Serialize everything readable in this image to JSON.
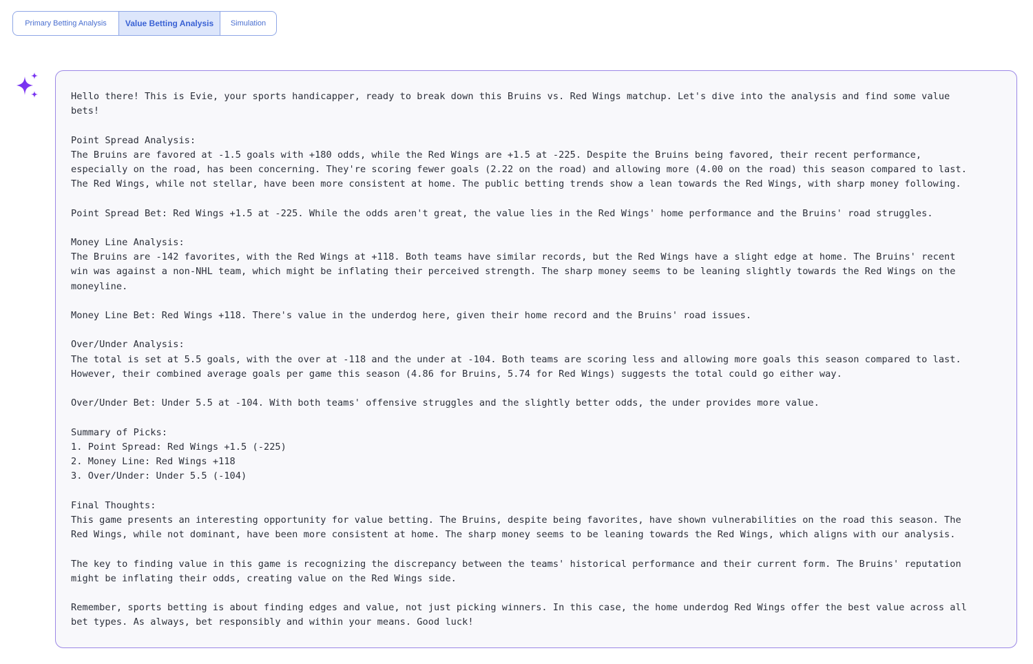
{
  "tabs": [
    {
      "label": "Primary Betting Analysis",
      "active": false
    },
    {
      "label": "Value Betting Analysis",
      "active": true
    },
    {
      "label": "Simulation",
      "active": false
    }
  ],
  "assistant_icon": "sparkles-icon",
  "colors": {
    "tab_border": "#8ea6e6",
    "tab_active_bg": "#dde6fb",
    "tab_text": "#4a6fd0",
    "bubble_border": "#9b87e6",
    "sparkle": "#7a2ff0"
  },
  "message": {
    "text": "Hello there! This is Evie, your sports handicapper, ready to break down this Bruins vs. Red Wings matchup. Let's dive into the analysis and find some value\nbets!\n\nPoint Spread Analysis:\nThe Bruins are favored at -1.5 goals with +180 odds, while the Red Wings are +1.5 at -225. Despite the Bruins being favored, their recent performance,\nespecially on the road, has been concerning. They're scoring fewer goals (2.22 on the road) and allowing more (4.00 on the road) this season compared to last.\nThe Red Wings, while not stellar, have been more consistent at home. The public betting trends show a lean towards the Red Wings, with sharp money following.\n\nPoint Spread Bet: Red Wings +1.5 at -225. While the odds aren't great, the value lies in the Red Wings' home performance and the Bruins' road struggles.\n\nMoney Line Analysis:\nThe Bruins are -142 favorites, with the Red Wings at +118. Both teams have similar records, but the Red Wings have a slight edge at home. The Bruins' recent\nwin was against a non-NHL team, which might be inflating their perceived strength. The sharp money seems to be leaning slightly towards the Red Wings on the\nmoneyline.\n\nMoney Line Bet: Red Wings +118. There's value in the underdog here, given their home record and the Bruins' road issues.\n\nOver/Under Analysis:\nThe total is set at 5.5 goals, with the over at -118 and the under at -104. Both teams are scoring less and allowing more goals this season compared to last.\nHowever, their combined average goals per game this season (4.86 for Bruins, 5.74 for Red Wings) suggests the total could go either way.\n\nOver/Under Bet: Under 5.5 at -104. With both teams' offensive struggles and the slightly better odds, the under provides more value.\n\nSummary of Picks:\n1. Point Spread: Red Wings +1.5 (-225)\n2. Money Line: Red Wings +118\n3. Over/Under: Under 5.5 (-104)\n\nFinal Thoughts:\nThis game presents an interesting opportunity for value betting. The Bruins, despite being favorites, have shown vulnerabilities on the road this season. The\nRed Wings, while not dominant, have been more consistent at home. The sharp money seems to be leaning towards the Red Wings, which aligns with our analysis.\n\nThe key to finding value in this game is recognizing the discrepancy between the teams' historical performance and their current form. The Bruins' reputation\nmight be inflating their odds, creating value on the Red Wings side.\n\nRemember, sports betting is about finding edges and value, not just picking winners. In this case, the home underdog Red Wings offer the best value across all\nbet types. As always, bet responsibly and within your means. Good luck!"
  }
}
